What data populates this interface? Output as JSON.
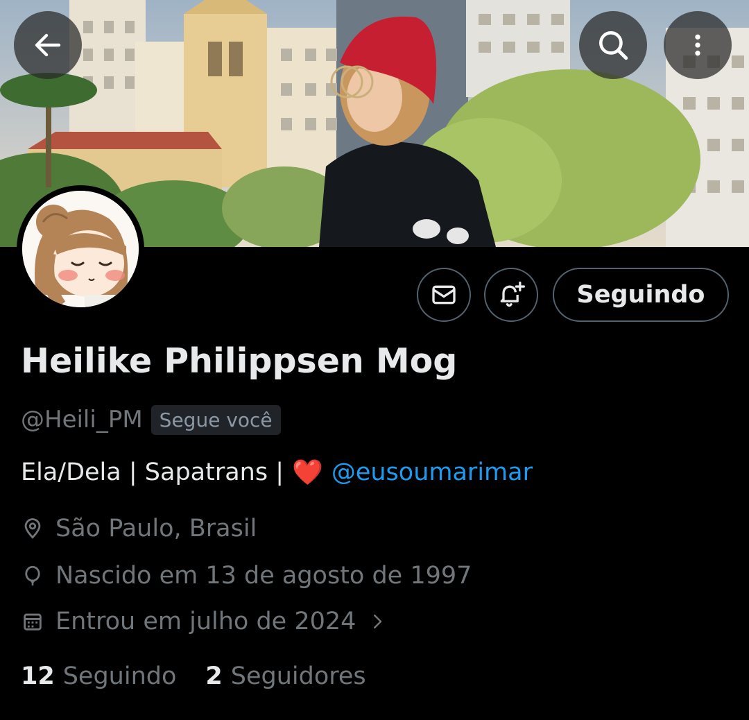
{
  "header": {
    "back_icon": "arrow-left-icon",
    "search_icon": "search-icon",
    "more_icon": "more-vertical-icon"
  },
  "profile": {
    "display_name": "Heilike Philippsen Mog",
    "handle": "@Heili_PM",
    "follows_you_badge": "Segue você",
    "bio": {
      "text": "Ela/Dela | Sapatrans |",
      "emoji": "❤️",
      "mention": "@eusoumarimar"
    },
    "location": "São Paulo, Brasil",
    "birth": "Nascido em 13 de agosto de 1997",
    "joined": "Entrou em julho de 2024",
    "following_count": "12",
    "following_label": "Seguindo",
    "followers_count": "2",
    "followers_label": "Seguidores"
  },
  "actions": {
    "message_icon": "envelope-icon",
    "notify_icon": "bell-plus-icon",
    "follow_button_label": "Seguindo"
  },
  "colors": {
    "background": "#000000",
    "text_primary": "#e7e9ea",
    "text_secondary": "#71767b",
    "accent_link": "#1d9bf0",
    "button_border": "#536471"
  }
}
